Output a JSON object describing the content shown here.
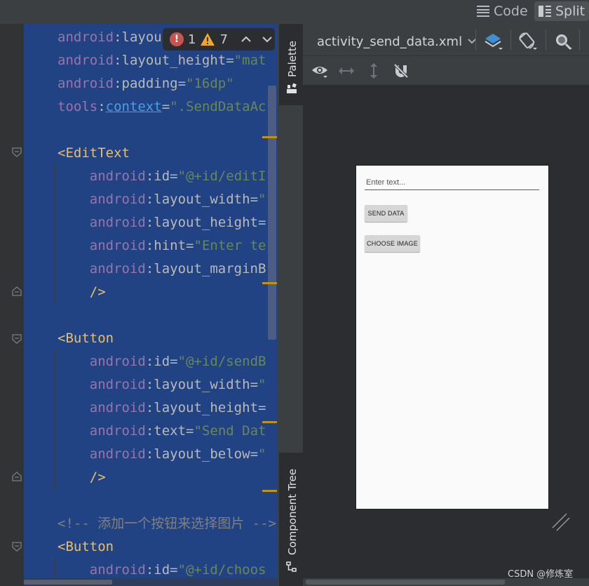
{
  "view_modes": {
    "code_label": "Code",
    "split_label": "Split"
  },
  "inspections": {
    "errors": "1",
    "warnings": "7"
  },
  "code_lines": [
    {
      "parts": [
        {
          "c": "ns",
          "t": "android"
        },
        {
          "c": "attr",
          "t": ":layou"
        }
      ]
    },
    {
      "parts": [
        {
          "c": "ns",
          "t": "android"
        },
        {
          "c": "attr",
          "t": ":layout_height"
        },
        {
          "c": "plain",
          "t": "="
        },
        {
          "c": "str",
          "t": "\"mat"
        }
      ]
    },
    {
      "parts": [
        {
          "c": "ns",
          "t": "android"
        },
        {
          "c": "attr",
          "t": ":padding"
        },
        {
          "c": "plain",
          "t": "="
        },
        {
          "c": "str",
          "t": "\"16dp\""
        }
      ]
    },
    {
      "parts": [
        {
          "c": "ns",
          "t": "tools"
        },
        {
          "c": "attr",
          "t": ":"
        },
        {
          "c": "link",
          "t": "context"
        },
        {
          "c": "plain",
          "t": "="
        },
        {
          "c": "str",
          "t": "\".SendDataAc"
        }
      ]
    },
    {
      "parts": []
    },
    {
      "parts": [
        {
          "c": "tag",
          "t": "<EditText"
        }
      ]
    },
    {
      "parts": [
        {
          "c": "ns",
          "t": "    android"
        },
        {
          "c": "attr",
          "t": ":id"
        },
        {
          "c": "plain",
          "t": "="
        },
        {
          "c": "str",
          "t": "\"@+id/editI"
        }
      ]
    },
    {
      "parts": [
        {
          "c": "ns",
          "t": "    android"
        },
        {
          "c": "attr",
          "t": ":layout_width"
        },
        {
          "c": "plain",
          "t": "="
        },
        {
          "c": "str",
          "t": "\""
        }
      ]
    },
    {
      "parts": [
        {
          "c": "ns",
          "t": "    android"
        },
        {
          "c": "attr",
          "t": ":layout_height"
        },
        {
          "c": "plain",
          "t": "="
        }
      ]
    },
    {
      "parts": [
        {
          "c": "ns",
          "t": "    android"
        },
        {
          "c": "attr",
          "t": ":hint"
        },
        {
          "c": "plain",
          "t": "="
        },
        {
          "c": "str",
          "t": "\"Enter te"
        }
      ]
    },
    {
      "parts": [
        {
          "c": "ns",
          "t": "    android"
        },
        {
          "c": "attr",
          "t": ":layout_marginB"
        }
      ]
    },
    {
      "parts": [
        {
          "c": "tag",
          "t": "    />"
        }
      ]
    },
    {
      "parts": []
    },
    {
      "parts": [
        {
          "c": "tag",
          "t": "<Button"
        }
      ]
    },
    {
      "parts": [
        {
          "c": "ns",
          "t": "    android"
        },
        {
          "c": "attr",
          "t": ":id"
        },
        {
          "c": "plain",
          "t": "="
        },
        {
          "c": "str",
          "t": "\"@+id/sendB"
        }
      ]
    },
    {
      "parts": [
        {
          "c": "ns",
          "t": "    android"
        },
        {
          "c": "attr",
          "t": ":layout_width"
        },
        {
          "c": "plain",
          "t": "="
        },
        {
          "c": "str",
          "t": "\""
        }
      ]
    },
    {
      "parts": [
        {
          "c": "ns",
          "t": "    android"
        },
        {
          "c": "attr",
          "t": ":layout_height"
        },
        {
          "c": "plain",
          "t": "="
        }
      ]
    },
    {
      "parts": [
        {
          "c": "ns",
          "t": "    android"
        },
        {
          "c": "attr",
          "t": ":text"
        },
        {
          "c": "plain",
          "t": "="
        },
        {
          "c": "str",
          "t": "\"Send Dat"
        }
      ]
    },
    {
      "parts": [
        {
          "c": "ns",
          "t": "    android"
        },
        {
          "c": "attr",
          "t": ":layout_below"
        },
        {
          "c": "plain",
          "t": "="
        },
        {
          "c": "str",
          "t": "\""
        }
      ]
    },
    {
      "parts": [
        {
          "c": "tag",
          "t": "    />"
        }
      ]
    },
    {
      "parts": []
    },
    {
      "parts": [
        {
          "c": "cmt",
          "t": "<!-- 添加一个按钮来选择图片 -->"
        }
      ]
    },
    {
      "parts": [
        {
          "c": "tag",
          "t": "<Button"
        }
      ]
    },
    {
      "parts": [
        {
          "c": "ns",
          "t": "    android"
        },
        {
          "c": "attr",
          "t": ":id"
        },
        {
          "c": "plain",
          "t": "="
        },
        {
          "c": "str",
          "t": "\"@+id/choos"
        }
      ]
    }
  ],
  "side_tabs": {
    "palette": "Palette",
    "component_tree": "Component Tree"
  },
  "design_toolbar": {
    "file_name": "activity_send_data.xml"
  },
  "preview": {
    "edit_hint": "Enter text...",
    "send_button": "SEND DATA",
    "choose_button": "CHOOSE IMAGE"
  },
  "watermark": "CSDN @修炼室",
  "icons": [
    "layers-icon",
    "orientation-icon",
    "zoom-icon",
    "eye-icon",
    "horizontal-arrow-icon",
    "vertical-arrow-icon",
    "magnet-off-icon",
    "resize-handle-icon"
  ]
}
